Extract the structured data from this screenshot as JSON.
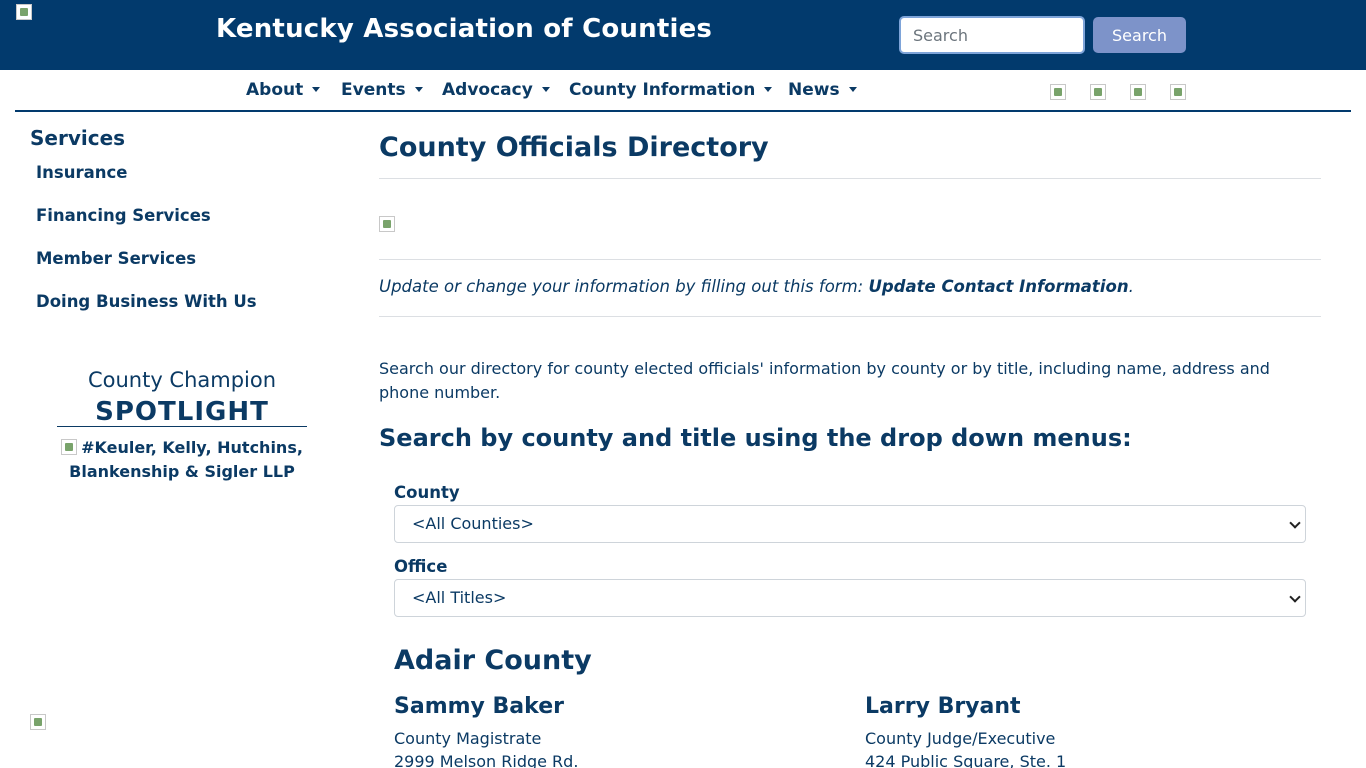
{
  "header": {
    "site_title": "Kentucky Association of Counties",
    "search_placeholder": "Search",
    "search_button": "Search",
    "brand_color": "#023a6d"
  },
  "nav": {
    "items": [
      {
        "label": "About"
      },
      {
        "label": "Events"
      },
      {
        "label": "Advocacy"
      },
      {
        "label": "County Information"
      },
      {
        "label": "News"
      }
    ]
  },
  "sidebar": {
    "title": "Services",
    "links": [
      {
        "label": "Insurance"
      },
      {
        "label": "Financing Services"
      },
      {
        "label": "Member Services"
      },
      {
        "label": "Doing Business With Us"
      }
    ],
    "champion_title": "County Champion",
    "champion_spotlight": "SPOTLIGHT",
    "champion_alt": "#Keuler, Kelly, Hutchins, Blankenship & Sigler LLP"
  },
  "main": {
    "page_title": "County Officials Directory",
    "update_text": "Update or change your information by filling out this form: ",
    "update_link": "Update Contact Information",
    "update_period": ".",
    "intro": "Search our directory for county elected officials' information by county or by title, including name, address and phone number.",
    "search_heading": "Search by county and title using the drop down menus:",
    "county_label": "County",
    "county_selected": "<All Counties>",
    "office_label": "Office",
    "office_selected": "<All Titles>",
    "county_heading": "Adair County",
    "officials": [
      {
        "name": "Sammy Baker",
        "title": "County Magistrate",
        "address": "2999 Melson Ridge Rd."
      },
      {
        "name": "Larry Bryant",
        "title": "County Judge/Executive",
        "address": "424 Public Square, Ste. 1"
      }
    ]
  }
}
